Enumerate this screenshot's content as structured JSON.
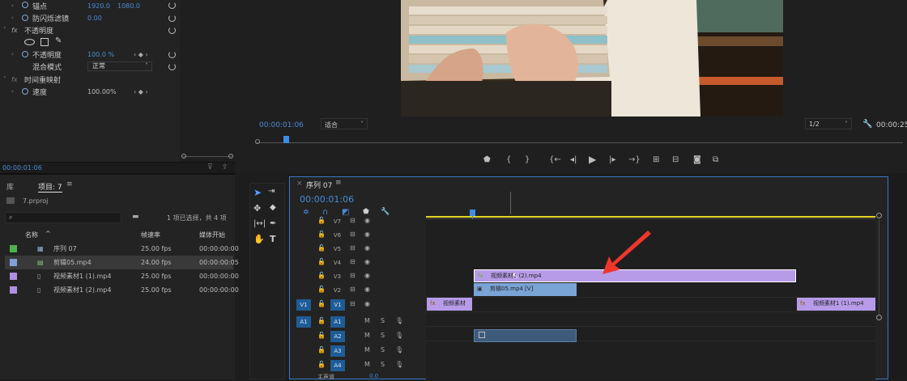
{
  "effect_controls": {
    "rows": [
      {
        "label": "锚点",
        "v1": "1920.0",
        "v2": "1080.0"
      },
      {
        "label": "防闪烁滤镜",
        "v1": "0.00"
      },
      {
        "label": "不透明度"
      },
      {
        "label": "不透明度",
        "v1": "100.0 %"
      },
      {
        "label": "混合模式",
        "select": "正常"
      },
      {
        "label": "时间重映射"
      },
      {
        "label": "速度",
        "v1": "100.00%"
      }
    ],
    "timecode": "00:00:01:06"
  },
  "monitor": {
    "timecode": "00:00:01:06",
    "fit": "适合",
    "resolution": "1/2",
    "end_tc": "00:00:25"
  },
  "project": {
    "tab_lib": "库",
    "tab_project": "项目: 7",
    "filename": "7.prproj",
    "search_placeholder": "",
    "selection_info": "1 项已选择，共 4 项",
    "columns": [
      "名称",
      "帧速率",
      "媒体开始"
    ],
    "items": [
      {
        "name": "序列 07",
        "fps": "25.00 fps",
        "start": "00:00:00:00",
        "color": "#4bb34b"
      },
      {
        "name": "剪辑05.mp4",
        "fps": "24.00 fps",
        "start": "00:00:00:05",
        "color": "#7fa0d8"
      },
      {
        "name": "视频素材1 (1).mp4",
        "fps": "25.00 fps",
        "start": "00:00:00:00",
        "color": "#b08ee0"
      },
      {
        "name": "视频素材1 (2).mp4",
        "fps": "25.00 fps",
        "start": "00:00:00:00",
        "color": "#b08ee0"
      }
    ]
  },
  "timeline": {
    "title": "序列 07",
    "timecode": "00:00:01:06",
    "video_tracks": [
      "V7",
      "V6",
      "V5",
      "V4",
      "V3",
      "V2",
      "V1"
    ],
    "audio_tracks": [
      "A1",
      "A2",
      "A3",
      "A4"
    ],
    "master": "主声道",
    "master_val": "0.0",
    "clips": {
      "v3": "视频素材1 (2).mp4",
      "v2": "剪辑05.mp4 [V]",
      "v1a": "视频素材",
      "v1b": "视频素材1 (1).mp4"
    }
  },
  "colors": {
    "accent": "#3a77c8",
    "clip_purple": "#b79be8",
    "clip_blue": "#7aa3d6",
    "arrow": "#f0372b"
  }
}
